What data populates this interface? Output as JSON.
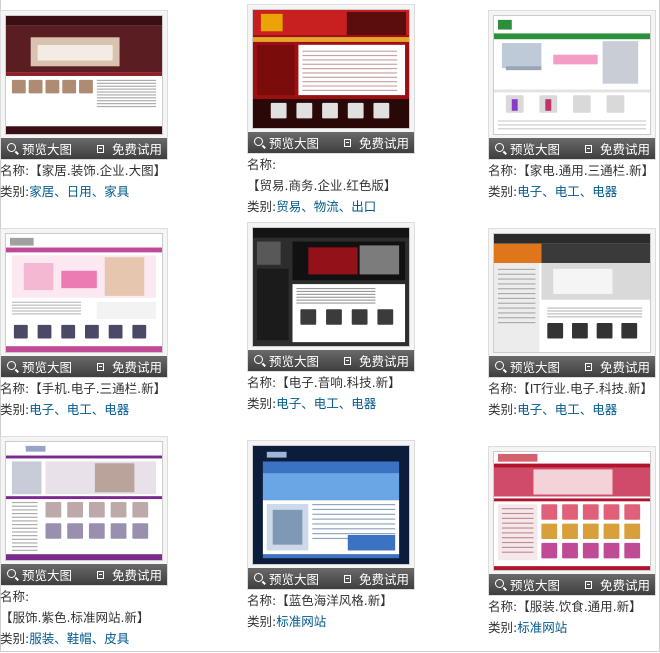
{
  "ui": {
    "preview_label": "预览大图",
    "trial_label": "免费试用",
    "name_prefix": "名称:",
    "category_prefix": "类别:",
    "category_separator": "、"
  },
  "templates": [
    {
      "name": "【家居.装饰.企业.大图】",
      "categories": [
        "家居",
        "日用",
        "家具"
      ],
      "thumb_theme": "home-furniture"
    },
    {
      "name": "【贸易.商务.企业.红色版】",
      "categories": [
        "贸易",
        "物流",
        "出口"
      ],
      "thumb_theme": "red-trade"
    },
    {
      "name": "【家电.通用.三通栏.新】",
      "categories": [
        "电子",
        "电工",
        "电器"
      ],
      "thumb_theme": "green-appliance"
    },
    {
      "name": "【手机.电子.三通栏.新】",
      "categories": [
        "电子",
        "电工",
        "电器"
      ],
      "thumb_theme": "pink-phone"
    },
    {
      "name": "【电子.音响.科技.新】",
      "categories": [
        "电子",
        "电工",
        "电器"
      ],
      "thumb_theme": "dark-electronics"
    },
    {
      "name": "【IT行业.电子.科技.新】",
      "categories": [
        "电子",
        "电工",
        "电器"
      ],
      "thumb_theme": "orange-it"
    },
    {
      "name": "【服饰.紫色.标准网站.新】",
      "categories": [
        "服装",
        "鞋帽",
        "皮具"
      ],
      "thumb_theme": "purple-fashion"
    },
    {
      "name": "【蓝色海洋风格.新】",
      "categories": [
        "标准网站"
      ],
      "thumb_theme": "blue-ocean"
    },
    {
      "name": "【服装.饮食.通用.新】",
      "categories": [
        "标准网站"
      ],
      "thumb_theme": "red-clothing-food"
    }
  ]
}
